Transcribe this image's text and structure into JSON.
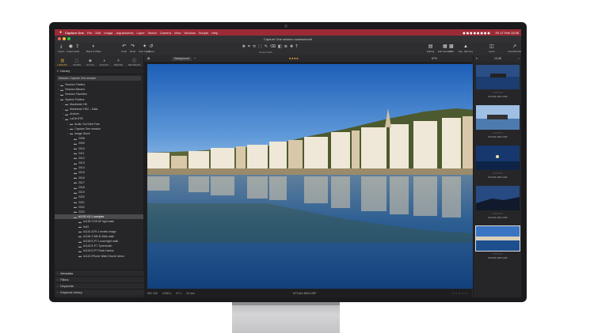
{
  "menubar": {
    "apple": "",
    "items": [
      "Capture One",
      "File",
      "Edit",
      "Image",
      "Adjustments",
      "Layer",
      "Select",
      "Camera",
      "View",
      "Window",
      "Scripts",
      "Help"
    ],
    "clock": "Fri 17 Feb 13:35"
  },
  "window": {
    "title": "Capture One session.cosessiondb"
  },
  "toolbar": {
    "left": [
      {
        "label": "Import",
        "icon": "⤓"
      },
      {
        "label": "Capture",
        "icon": "◉"
      },
      {
        "label": "Edit",
        "icon": "⇪"
      },
      {
        "label": "Black & White",
        "icon": "◐"
      },
      {
        "label": "Undo",
        "icon": "↶"
      },
      {
        "label": "Redo",
        "icon": "↷"
      },
      {
        "label": "Auto Adjust",
        "icon": "✦"
      },
      {
        "label": "Reset",
        "icon": "↺"
      }
    ],
    "cursor_label": "Cursor Tools",
    "right": [
      {
        "label": "Editing",
        "icon": "▤"
      },
      {
        "label": "Edit Selected",
        "icon": "▦"
      },
      {
        "label": "Grid",
        "icon": "▩"
      },
      {
        "label": "Exp. Warning",
        "icon": "▲"
      },
      {
        "label": "Learn",
        "icon": "◫"
      },
      {
        "label": "Cloud/Profile",
        "icon": "↗"
      }
    ]
  },
  "tool_tabs": [
    "LIBRARY",
    "SHAPE",
    "STYLE",
    "ADJUST",
    "REFINE",
    "METADATA"
  ],
  "library": {
    "header": "Library",
    "session": "Session: Capture One session",
    "tree": [
      {
        "label": "Session Folders",
        "indent": 0,
        "sel": false
      },
      {
        "label": "Session Albums",
        "indent": 0,
        "sel": false
      },
      {
        "label": "Session Favorites",
        "indent": 0,
        "sel": false
      },
      {
        "label": "System Folders",
        "indent": 0,
        "sel": false
      },
      {
        "label": "Macintosh HD",
        "indent": 1,
        "sel": false
      },
      {
        "label": "Macintosh HD2 – Data",
        "indent": 1,
        "sel": false
      },
      {
        "label": "Archive",
        "indent": 1,
        "sel": false
      },
      {
        "label": "LaCie 8TB",
        "indent": 1,
        "sel": false
      },
      {
        "label": "Audio YouTube Free",
        "indent": 2,
        "sel": false
      },
      {
        "label": "Capture One session",
        "indent": 2,
        "sel": false
      },
      {
        "label": "Image Stock",
        "indent": 2,
        "sel": false
      },
      {
        "label": "2008",
        "indent": 3,
        "sel": false
      },
      {
        "label": "2009",
        "indent": 3,
        "sel": false
      },
      {
        "label": "2010",
        "indent": 3,
        "sel": false
      },
      {
        "label": "2011",
        "indent": 3,
        "sel": false
      },
      {
        "label": "2012",
        "indent": 3,
        "sel": false
      },
      {
        "label": "2013",
        "indent": 3,
        "sel": false
      },
      {
        "label": "2014",
        "indent": 3,
        "sel": false
      },
      {
        "label": "2015",
        "indent": 3,
        "sel": false
      },
      {
        "label": "2016",
        "indent": 3,
        "sel": false
      },
      {
        "label": "2017",
        "indent": 3,
        "sel": false
      },
      {
        "label": "2018",
        "indent": 3,
        "sel": false
      },
      {
        "label": "2019",
        "indent": 3,
        "sel": false
      },
      {
        "label": "2020",
        "indent": 3,
        "sel": false
      },
      {
        "label": "2021",
        "indent": 3,
        "sel": false
      },
      {
        "label": "2022",
        "indent": 3,
        "sel": false
      },
      {
        "label": "2023",
        "indent": 3,
        "sel": false
      },
      {
        "label": "#1133 XX-1 samples",
        "indent": 3,
        "sel": true
      },
      {
        "label": "#1135 COE AF tight walk",
        "indent": 4,
        "sel": false
      },
      {
        "label": "Sel3",
        "indent": 4,
        "sel": false
      },
      {
        "label": "#1141 A7R 4 review image",
        "indent": 4,
        "sel": false
      },
      {
        "label": "#1154 Z-M6 III Wick walk",
        "indent": 4,
        "sel": false
      },
      {
        "label": "#1138 E-P7 Local night walk",
        "indent": 4,
        "sel": false
      },
      {
        "label": "#1143 E-P7 Tynemouth",
        "indent": 4,
        "sel": false
      },
      {
        "label": "#1143 E-P7 Rock Harbor",
        "indent": 4,
        "sel": false
      },
      {
        "label": "#1141 iPhone Walk Church demo",
        "indent": 4,
        "sel": false
      }
    ],
    "sections": [
      "Metadata",
      "Filters",
      "Keywords",
      "Keyword Library"
    ]
  },
  "viewer": {
    "background_label": "Background",
    "zoom": "67%",
    "footer_left": [
      "ISO 100",
      "1/250 s",
      "f/7.1",
      "24 mm"
    ],
    "filename": "KP1184-3805.ORF"
  },
  "browser": {
    "count": "1/148",
    "thumbs": [
      "KP1184-3801.ORF",
      "KP1184-3802.ORF",
      "KP1184-3803.ORF",
      "KP1184-3804.ORF",
      "KP1184-3805.ORF"
    ]
  },
  "colors": {
    "accent": "#e3a23a",
    "menubar": "#9a2b36"
  }
}
